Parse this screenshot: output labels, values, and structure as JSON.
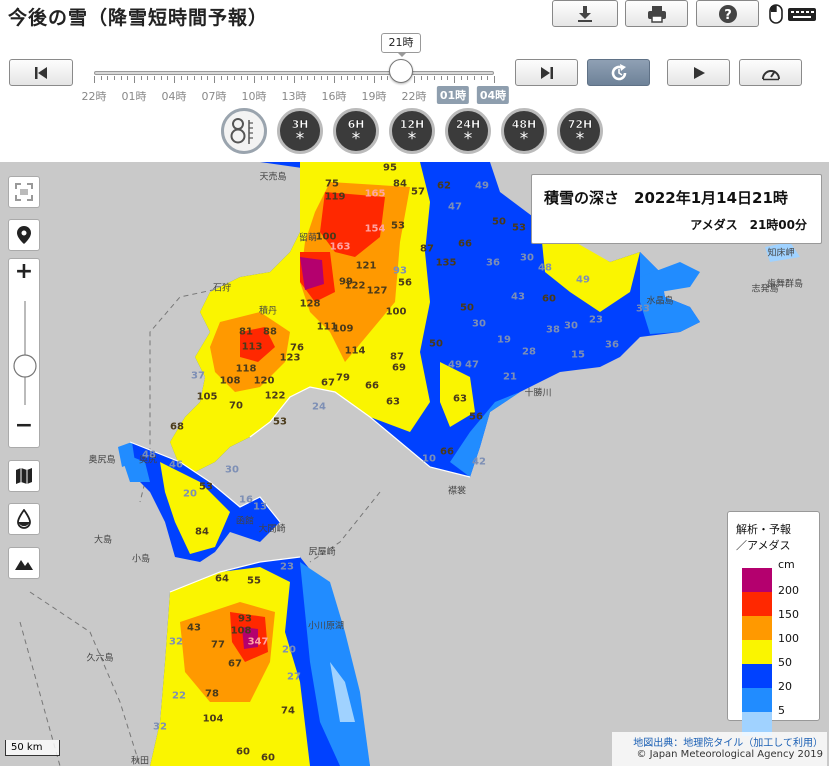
{
  "header": {
    "title": "今後の雪（降雪短時間予報）",
    "current_time": "21時",
    "timeline_labels": [
      "22時",
      "01時",
      "04時",
      "07時",
      "10時",
      "13時",
      "16時",
      "19時",
      "22時",
      "01時",
      "04時"
    ],
    "forecast_labels": [
      "01時",
      "04時"
    ],
    "period_buttons": [
      "3H",
      "6H",
      "12H",
      "24H",
      "48H",
      "72H"
    ]
  },
  "info": {
    "title": "積雪の深さ　2022年1月14日21時",
    "subtitle": "アメダス　21時00分"
  },
  "legend": {
    "title1": "解析・予報",
    "title2": "／アメダス",
    "unit": "cm",
    "items": [
      {
        "label": "200",
        "color": "#b4006e"
      },
      {
        "label": "150",
        "color": "#ff2800"
      },
      {
        "label": "100",
        "color": "#ff9900"
      },
      {
        "label": "50",
        "color": "#faf500"
      },
      {
        "label": "20",
        "color": "#0041ff"
      },
      {
        "label": "5",
        "color": "#218cff"
      },
      {
        "label": "",
        "color": "#a0d2ff"
      }
    ]
  },
  "map": {
    "scale": "50 km",
    "credit_source": "地図出典：地理院タイル（加工して利用）",
    "copyright": "© Japan Meteorological Agency 2019",
    "places": [
      "天売島",
      "留萌",
      "石狩",
      "積丹",
      "奥尻島",
      "奥尻",
      "函館",
      "大島",
      "小島",
      "大間崎",
      "尻屋崎",
      "十勝川",
      "水晶島",
      "志発島",
      "歯舞群島",
      "襟裳",
      "知床岬",
      "小川原湖",
      "久六島",
      "秋田"
    ],
    "values": [
      {
        "v": "95",
        "c": "d"
      },
      {
        "v": "75",
        "c": "d"
      },
      {
        "v": "84",
        "c": "d"
      },
      {
        "v": "57",
        "c": "d"
      },
      {
        "v": "62",
        "c": "d"
      },
      {
        "v": "49",
        "c": "b"
      },
      {
        "v": "119",
        "c": "d"
      },
      {
        "v": "165",
        "c": "r"
      },
      {
        "v": "47",
        "c": "b"
      },
      {
        "v": "154",
        "c": "r"
      },
      {
        "v": "53",
        "c": "d"
      },
      {
        "v": "100",
        "c": "d"
      },
      {
        "v": "163",
        "c": "r"
      },
      {
        "v": "87",
        "c": "d"
      },
      {
        "v": "66",
        "c": "d"
      },
      {
        "v": "50",
        "c": "d"
      },
      {
        "v": "53",
        "c": "d"
      },
      {
        "v": "121",
        "c": "d"
      },
      {
        "v": "93",
        "c": "b"
      },
      {
        "v": "135",
        "c": "d"
      },
      {
        "v": "36",
        "c": "b"
      },
      {
        "v": "30",
        "c": "b"
      },
      {
        "v": "48",
        "c": "b"
      },
      {
        "v": "99",
        "c": "d"
      },
      {
        "v": "56",
        "c": "d"
      },
      {
        "v": "122",
        "c": "d"
      },
      {
        "v": "127",
        "c": "d"
      },
      {
        "v": "49",
        "c": "b"
      },
      {
        "v": "43",
        "c": "b"
      },
      {
        "v": "60",
        "c": "d"
      },
      {
        "v": "128",
        "c": "d"
      },
      {
        "v": "100",
        "c": "d"
      },
      {
        "v": "50",
        "c": "d"
      },
      {
        "v": "33",
        "c": "b"
      },
      {
        "v": "81",
        "c": "d"
      },
      {
        "v": "88",
        "c": "d"
      },
      {
        "v": "111",
        "c": "d"
      },
      {
        "v": "109",
        "c": "d"
      },
      {
        "v": "30",
        "c": "b"
      },
      {
        "v": "38",
        "c": "b"
      },
      {
        "v": "30",
        "c": "b"
      },
      {
        "v": "23",
        "c": "b"
      },
      {
        "v": "113",
        "c": "d"
      },
      {
        "v": "76",
        "c": "d"
      },
      {
        "v": "114",
        "c": "d"
      },
      {
        "v": "50",
        "c": "d"
      },
      {
        "v": "19",
        "c": "b"
      },
      {
        "v": "28",
        "c": "b"
      },
      {
        "v": "15",
        "c": "b"
      },
      {
        "v": "36",
        "c": "b"
      },
      {
        "v": "118",
        "c": "d"
      },
      {
        "v": "123",
        "c": "d"
      },
      {
        "v": "87",
        "c": "d"
      },
      {
        "v": "49",
        "c": "b"
      },
      {
        "v": "47",
        "c": "b"
      },
      {
        "v": "37",
        "c": "b"
      },
      {
        "v": "108",
        "c": "d"
      },
      {
        "v": "120",
        "c": "d"
      },
      {
        "v": "67",
        "c": "d"
      },
      {
        "v": "79",
        "c": "d"
      },
      {
        "v": "66",
        "c": "d"
      },
      {
        "v": "69",
        "c": "d"
      },
      {
        "v": "21",
        "c": "b"
      },
      {
        "v": "105",
        "c": "d"
      },
      {
        "v": "122",
        "c": "d"
      },
      {
        "v": "70",
        "c": "d"
      },
      {
        "v": "24",
        "c": "b"
      },
      {
        "v": "63",
        "c": "d"
      },
      {
        "v": "63",
        "c": "d"
      },
      {
        "v": "53",
        "c": "d"
      },
      {
        "v": "56",
        "c": "d"
      },
      {
        "v": "68",
        "c": "d"
      },
      {
        "v": "48",
        "c": "b"
      },
      {
        "v": "46",
        "c": "b"
      },
      {
        "v": "30",
        "c": "b"
      },
      {
        "v": "66",
        "c": "d"
      },
      {
        "v": "42",
        "c": "b"
      },
      {
        "v": "53",
        "c": "d"
      },
      {
        "v": "20",
        "c": "b"
      },
      {
        "v": "16",
        "c": "b"
      },
      {
        "v": "84",
        "c": "d"
      },
      {
        "v": "64",
        "c": "d"
      },
      {
        "v": "55",
        "c": "d"
      },
      {
        "v": "23",
        "c": "b"
      },
      {
        "v": "43",
        "c": "d"
      },
      {
        "v": "93",
        "c": "d"
      },
      {
        "v": "108",
        "c": "d"
      },
      {
        "v": "347",
        "c": "r"
      },
      {
        "v": "32",
        "c": "b"
      },
      {
        "v": "77",
        "c": "d"
      },
      {
        "v": "67",
        "c": "d"
      },
      {
        "v": "20",
        "c": "b"
      },
      {
        "v": "27",
        "c": "b"
      },
      {
        "v": "22",
        "c": "b"
      },
      {
        "v": "78",
        "c": "d"
      },
      {
        "v": "104",
        "c": "d"
      },
      {
        "v": "74",
        "c": "d"
      },
      {
        "v": "32",
        "c": "b"
      },
      {
        "v": "60",
        "c": "d"
      },
      {
        "v": "60",
        "c": "d"
      },
      {
        "v": "10",
        "c": "b"
      },
      {
        "v": "13",
        "c": "b"
      }
    ]
  }
}
